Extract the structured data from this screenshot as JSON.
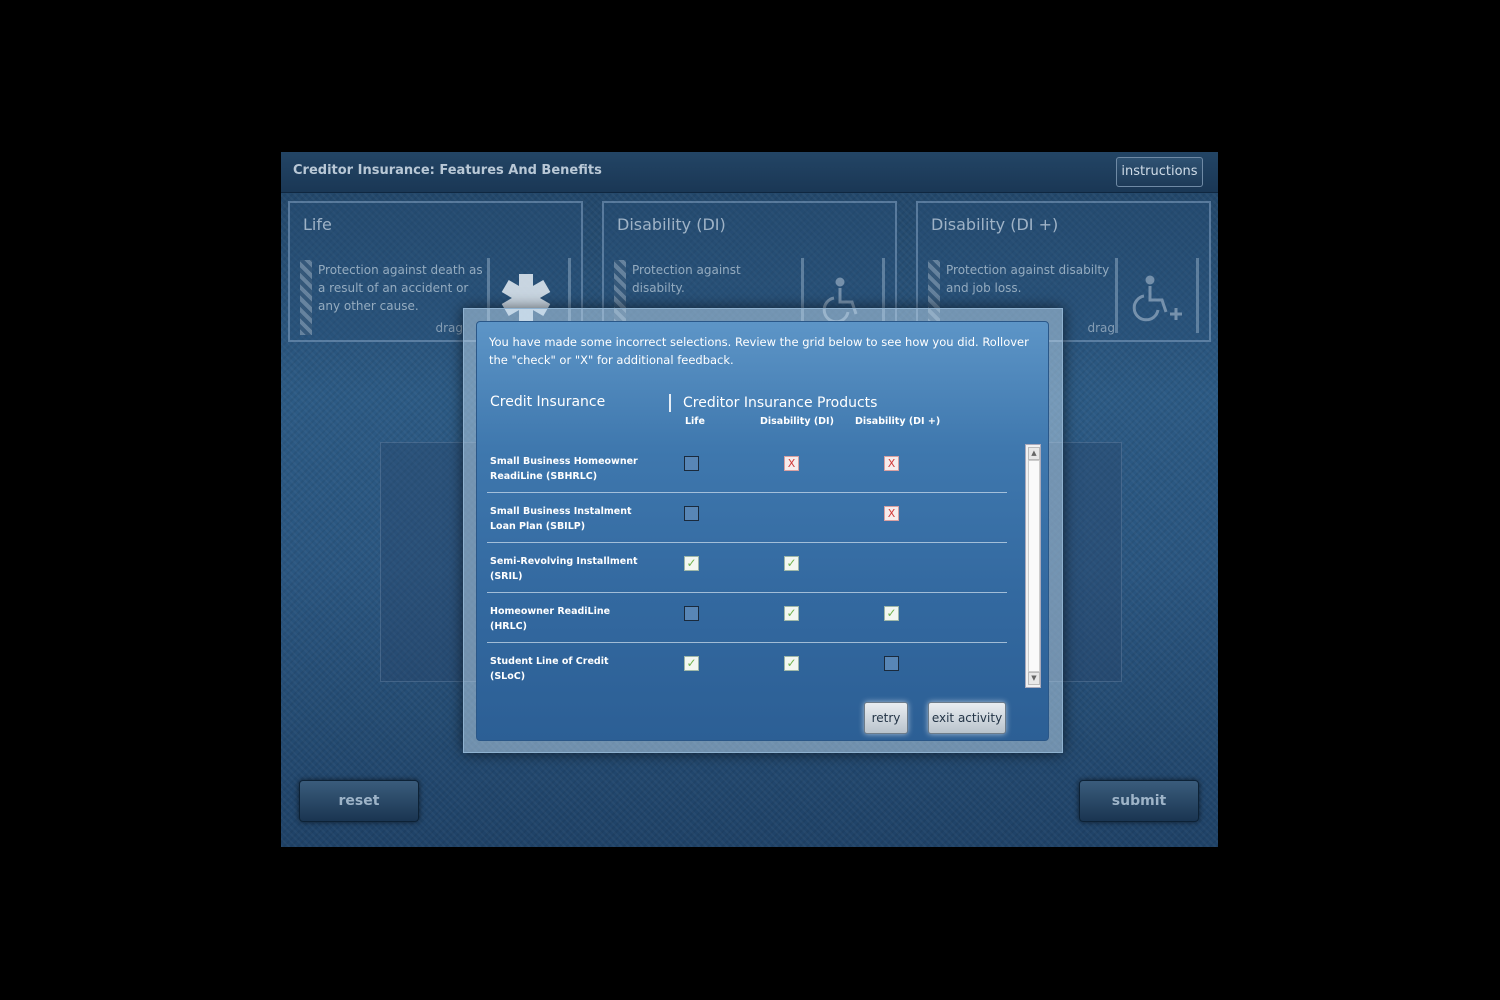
{
  "app": {
    "title": "Creditor Insurance: Features And Benefits",
    "instructions_label": "instructions"
  },
  "categories": [
    {
      "title": "Life",
      "desc": "Protection against death as a result of an accident or any other cause.",
      "drag": "drag"
    },
    {
      "title": "Disability (DI)",
      "desc": "Protection against disabilty.",
      "drag": ""
    },
    {
      "title": "Disability (DI +)",
      "desc": "Protection against disabilty and job loss.",
      "drag": "drag"
    }
  ],
  "footer": {
    "reset_label": "reset",
    "submit_label": "submit"
  },
  "modal": {
    "message": "You have made some incorrect selections.  Review the grid below to see how you did.  Rollover the \"check\" or \"X\" for additional feedback.",
    "left_header": "Credit Insurance",
    "right_header": "Creditor Insurance Products",
    "columns": [
      "Life",
      "Disability (DI)",
      "Disability (DI +)"
    ],
    "rows": [
      {
        "label": "Small Business Homeowner ReadiLine (SBHRLC)",
        "cells": [
          "empty",
          "x",
          "x"
        ]
      },
      {
        "label": "Small Business Instalment Loan Plan (SBILP)",
        "cells": [
          "empty",
          "none",
          "x"
        ]
      },
      {
        "label": "Semi-Revolving Installment (SRIL)",
        "cells": [
          "check",
          "check",
          "none"
        ]
      },
      {
        "label": "Homeowner ReadiLine (HRLC)",
        "cells": [
          "empty",
          "check",
          "check"
        ]
      },
      {
        "label": "Student Line of Credit (SLoC)",
        "cells": [
          "check",
          "check",
          "empty"
        ]
      }
    ],
    "retry_label": "retry",
    "exit_label": "exit activity"
  },
  "colors": {
    "modal_blue": "#3f78ae",
    "check_green": "#6fb24d",
    "x_red": "#d13a3a"
  }
}
